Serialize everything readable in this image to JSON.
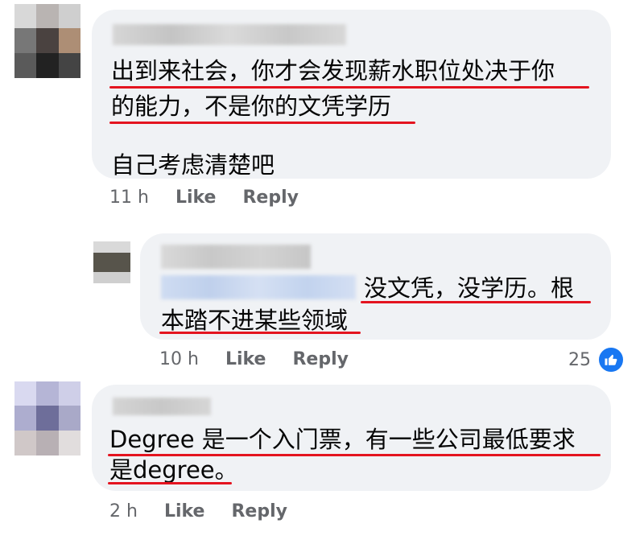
{
  "comments": [
    {
      "lines": [
        "出到来社会，你才会发现薪水职位处决于你",
        "的能力，不是你的文凭学历",
        "",
        "自己考虑清楚吧"
      ],
      "time": "11 h",
      "like_label": "Like",
      "reply_label": "Reply"
    },
    {
      "lines": [
        "没文凭，没学历。根",
        "本踏不进某些领域"
      ],
      "time": "10 h",
      "like_label": "Like",
      "reply_label": "Reply",
      "reaction_count": "25",
      "reaction_icon": "thumbs-up-icon"
    },
    {
      "lines": [
        "Degree 是一个入门票，有一些公司最低要求",
        "是degree。"
      ],
      "time": "2 h",
      "like_label": "Like",
      "reply_label": "Reply"
    }
  ],
  "colors": {
    "bubble": "#f0f2f5",
    "underline": "#e4141f",
    "like_blue": "#1877f2",
    "meta_gray": "#65676b"
  }
}
